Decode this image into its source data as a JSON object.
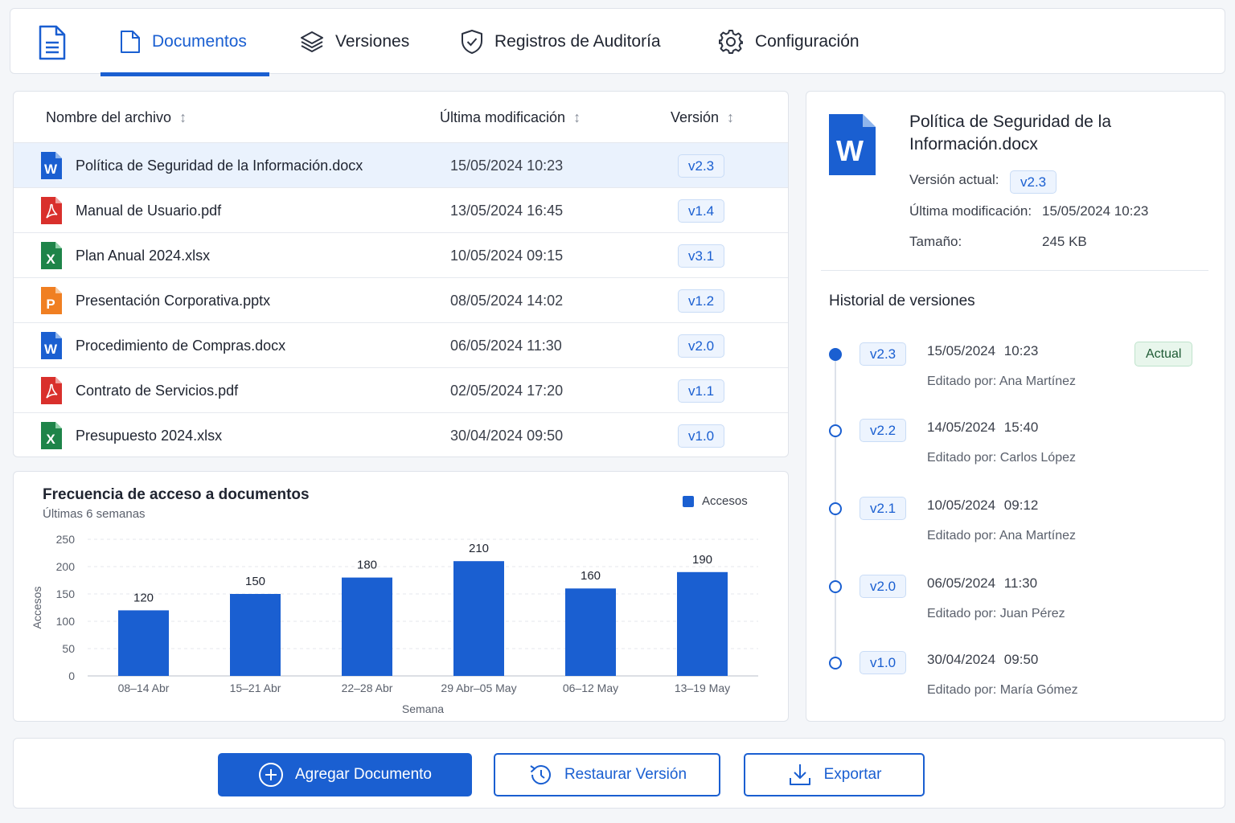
{
  "nav": {
    "tabs": [
      {
        "label": "Documentos",
        "icon": "document-icon",
        "active": true
      },
      {
        "label": "Versiones",
        "icon": "layers-icon"
      },
      {
        "label": "Registros de Auditoría",
        "icon": "shield-check-icon"
      },
      {
        "label": "Configuración",
        "icon": "gear-icon"
      }
    ],
    "accent": "#1a5fd1"
  },
  "table": {
    "headers": {
      "name": "Nombre del archivo",
      "modified": "Última modificación",
      "version": "Versión"
    },
    "rows": [
      {
        "name": "Política de Seguridad de la Información.docx",
        "modified": "15/05/2024 10:23",
        "version": "v2.3",
        "type": "word",
        "selected": true
      },
      {
        "name": "Manual de Usuario.pdf",
        "modified": "13/05/2024 16:45",
        "version": "v1.4",
        "type": "pdf"
      },
      {
        "name": "Plan Anual 2024.xlsx",
        "modified": "10/05/2024 09:15",
        "version": "v3.1",
        "type": "excel"
      },
      {
        "name": "Presentación Corporativa.pptx",
        "modified": "08/05/2024 14:02",
        "version": "v1.2",
        "type": "powerpoint"
      },
      {
        "name": "Procedimiento de Compras.docx",
        "modified": "06/05/2024 11:30",
        "version": "v2.0",
        "type": "word"
      },
      {
        "name": "Contrato de Servicios.pdf",
        "modified": "02/05/2024 17:20",
        "version": "v1.1",
        "type": "pdf"
      },
      {
        "name": "Presupuesto 2024.xlsx",
        "modified": "30/04/2024 09:50",
        "version": "v1.0",
        "type": "excel"
      }
    ]
  },
  "chart": {
    "title": "Frecuencia de acceso a documentos",
    "subtitle": "Últimas 6 semanas",
    "legend": "Accesos"
  },
  "chart_data": {
    "type": "bar",
    "categories": [
      "08–14 Abr",
      "15–21 Abr",
      "22–28 Abr",
      "29 Abr–05 May",
      "06–12 May",
      "13–19 May"
    ],
    "series": [
      {
        "name": "Accesos",
        "values": [
          120,
          150,
          180,
          210,
          160,
          190
        ]
      }
    ],
    "xlabel": "Semana",
    "ylabel": "Accesos",
    "ylim": [
      0,
      250
    ],
    "yticks": [
      0,
      50,
      100,
      150,
      200,
      250
    ],
    "grid": true,
    "legend_position": "top-right",
    "color": "#1a5fd1"
  },
  "details": {
    "title": "Política de Seguridad de la Información.docx",
    "version_label": "Versión actual:",
    "version": "v2.3",
    "modified_label": "Última modificación:",
    "modified": "15/05/2024 10:23",
    "size_label": "Tamaño:",
    "size": "245 KB",
    "history_title": "Historial de versiones",
    "history": [
      {
        "version": "v2.3",
        "date": "15/05/2024 10:23",
        "editor": "Editado por: Ana Martínez",
        "current": true,
        "current_label": "Actual"
      },
      {
        "version": "v2.2",
        "date": "14/05/2024 15:40",
        "editor": "Editado por: Carlos López"
      },
      {
        "version": "v2.1",
        "date": "10/05/2024 09:12",
        "editor": "Editado por: Ana Martínez"
      },
      {
        "version": "v2.0",
        "date": "06/05/2024 11:30",
        "editor": "Editado por: Juan Pérez"
      },
      {
        "version": "v1.0",
        "date": "30/04/2024 09:50",
        "editor": "Editado por: María Gómez"
      }
    ]
  },
  "actions": {
    "add": "Agregar Documento",
    "restore": "Restaurar Versión",
    "export": "Exportar"
  }
}
